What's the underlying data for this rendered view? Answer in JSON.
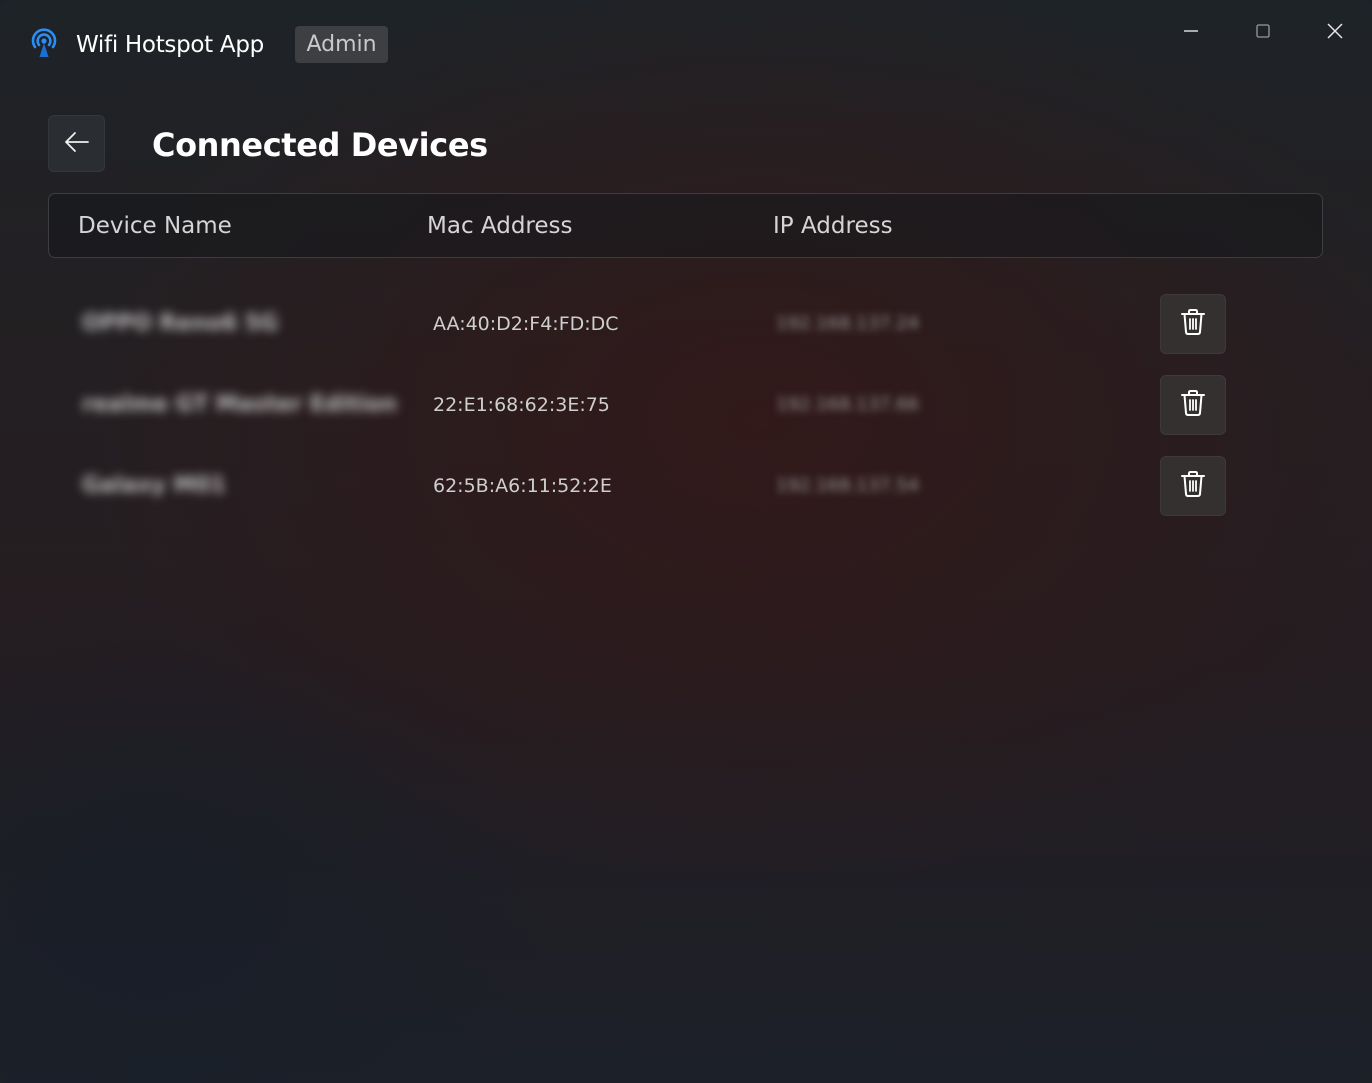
{
  "app": {
    "title": "Wifi Hotspot App",
    "role_badge": "Admin"
  },
  "window_controls": {
    "minimize_icon": "minimize-icon",
    "maximize_icon": "maximize-icon",
    "close_icon": "close-icon"
  },
  "page": {
    "title": "Connected Devices",
    "back_icon": "arrow-left-icon"
  },
  "table": {
    "columns": [
      "Device Name",
      "Mac Address",
      "IP Address"
    ],
    "rows": [
      {
        "device_name": "OPPO Reno6 5G",
        "mac": "AA:40:D2:F4:FD:DC",
        "ip": "192.168.137.24",
        "action_icon": "trash-icon"
      },
      {
        "device_name": "realme GT Master Edition",
        "mac": "22:E1:68:62:3E:75",
        "ip": "192.168.137.66",
        "action_icon": "trash-icon"
      },
      {
        "device_name": "Galaxy M01",
        "mac": "62:5B:A6:11:52:2E",
        "ip": "192.168.137.54",
        "action_icon": "trash-icon"
      }
    ]
  },
  "colors": {
    "accent": "#2b8ef5",
    "badge_bg": "#3d3f42",
    "delete_button_bg": "#34302f"
  }
}
